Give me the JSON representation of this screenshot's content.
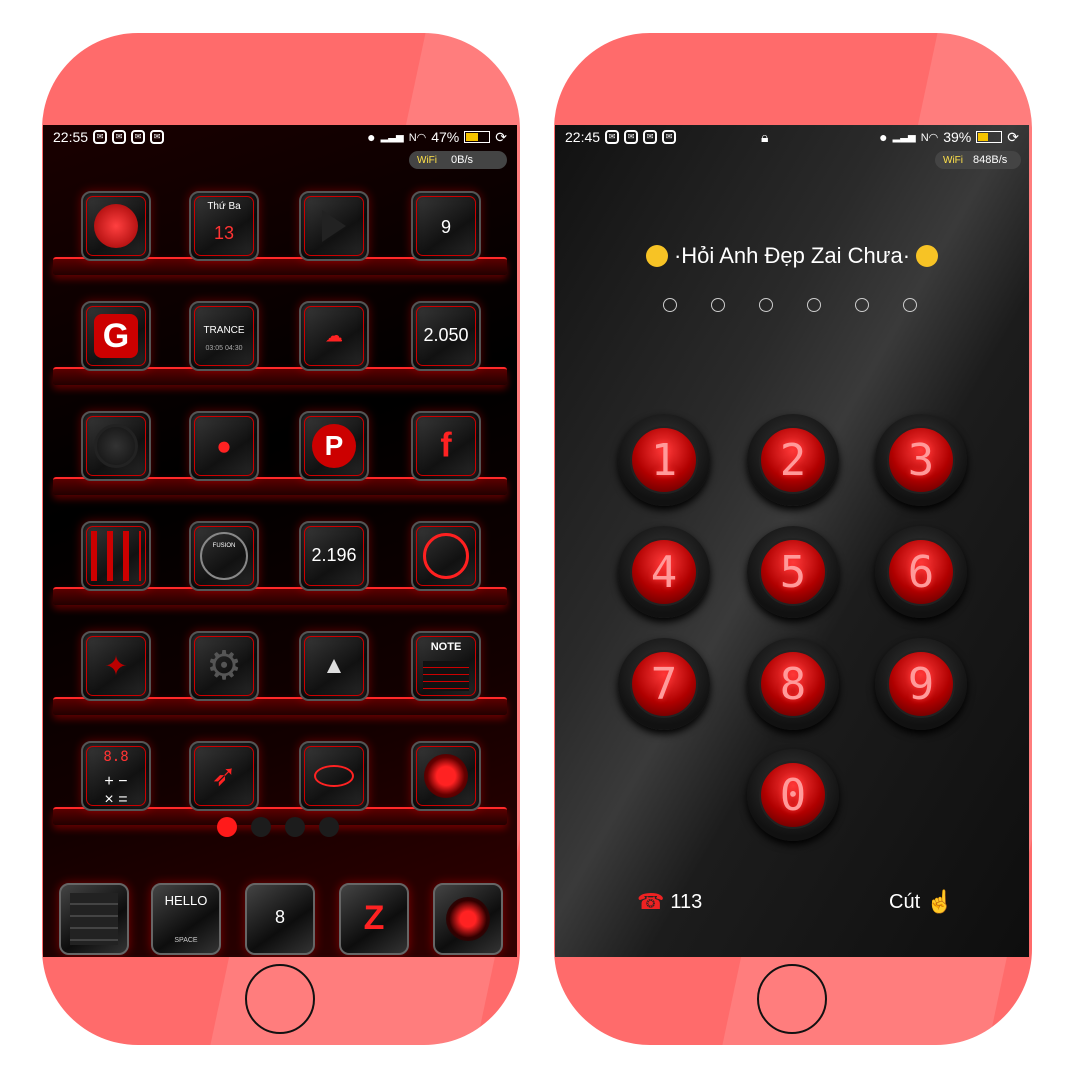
{
  "left_phone": {
    "status": {
      "time": "22:55",
      "battery": "47%",
      "battery_level": 0.47,
      "notification_icons": [
        "app-notification-icon",
        "app-notification-icon",
        "app-notification-icon",
        "app-notification-icon"
      ],
      "right_icons": [
        "location-icon",
        "signal-icon",
        "nfc-wifi-icon",
        "battery-icon",
        "sync-icon"
      ]
    },
    "wifi_speed": {
      "label": "WiFi",
      "value": "0B/s"
    },
    "apps": [
      {
        "name": "flower-app-icon",
        "text": ""
      },
      {
        "name": "calendar-app-icon",
        "text": "Thứ Ba",
        "sub": "13"
      },
      {
        "name": "play-app-icon",
        "text": ""
      },
      {
        "name": "weather-app-icon",
        "text": "9"
      },
      {
        "name": "g-app-icon",
        "text": ""
      },
      {
        "name": "trance-music-app-icon",
        "text": "TRANCE",
        "sub": "03:05   04:30"
      },
      {
        "name": "cloud-folder-app-icon",
        "text": ""
      },
      {
        "name": "mail-app-icon",
        "text": "2.050"
      },
      {
        "name": "record-app-icon",
        "text": ""
      },
      {
        "name": "apple-store-app-icon",
        "text": ""
      },
      {
        "name": "pinterest-app-icon",
        "text": ""
      },
      {
        "name": "facebook-app-icon",
        "text": ""
      },
      {
        "name": "maps-g-app-icon",
        "text": ""
      },
      {
        "name": "fusion-clock-app-icon",
        "text": "FUSION"
      },
      {
        "name": "youtube-app-icon",
        "text": "2.196"
      },
      {
        "name": "music-app-icon",
        "text": ""
      },
      {
        "name": "twitter-app-icon",
        "text": ""
      },
      {
        "name": "settings-app-icon",
        "text": ""
      },
      {
        "name": "road-maps-app-icon",
        "text": ""
      },
      {
        "name": "note-app-icon",
        "text": "NOTE"
      },
      {
        "name": "calculator-app-icon",
        "text": "8.8"
      },
      {
        "name": "compass-app-icon",
        "text": ""
      },
      {
        "name": "eye-app-icon",
        "text": ""
      },
      {
        "name": "camera-lens-app-icon",
        "text": ""
      }
    ],
    "page_dots": {
      "count": 4,
      "active": 0
    },
    "dock": [
      {
        "name": "phone-keypad-dock-icon",
        "text": ""
      },
      {
        "name": "keyboard-hello-dock-icon",
        "text": "HELLO",
        "sub": "SPACE"
      },
      {
        "name": "messages-dock-icon",
        "text": "8"
      },
      {
        "name": "zalo-dock-icon",
        "text": "Z"
      },
      {
        "name": "camera-dock-icon",
        "text": ""
      }
    ]
  },
  "right_phone": {
    "status": {
      "time": "22:45",
      "battery": "39%",
      "battery_level": 0.39,
      "right_icons": [
        "location-icon",
        "signal-icon",
        "nfc-wifi-icon",
        "battery-icon",
        "sync-icon"
      ]
    },
    "wifi_speed": {
      "label": "WiFi",
      "value": "848B/s"
    },
    "lock_title": "·Hỏi Anh Đẹp Zai Chưa·",
    "pin_count": 6,
    "keys": [
      "1",
      "2",
      "3",
      "4",
      "5",
      "6",
      "7",
      "8",
      "9",
      "0"
    ],
    "emergency": "113",
    "cancel": "Cút"
  }
}
